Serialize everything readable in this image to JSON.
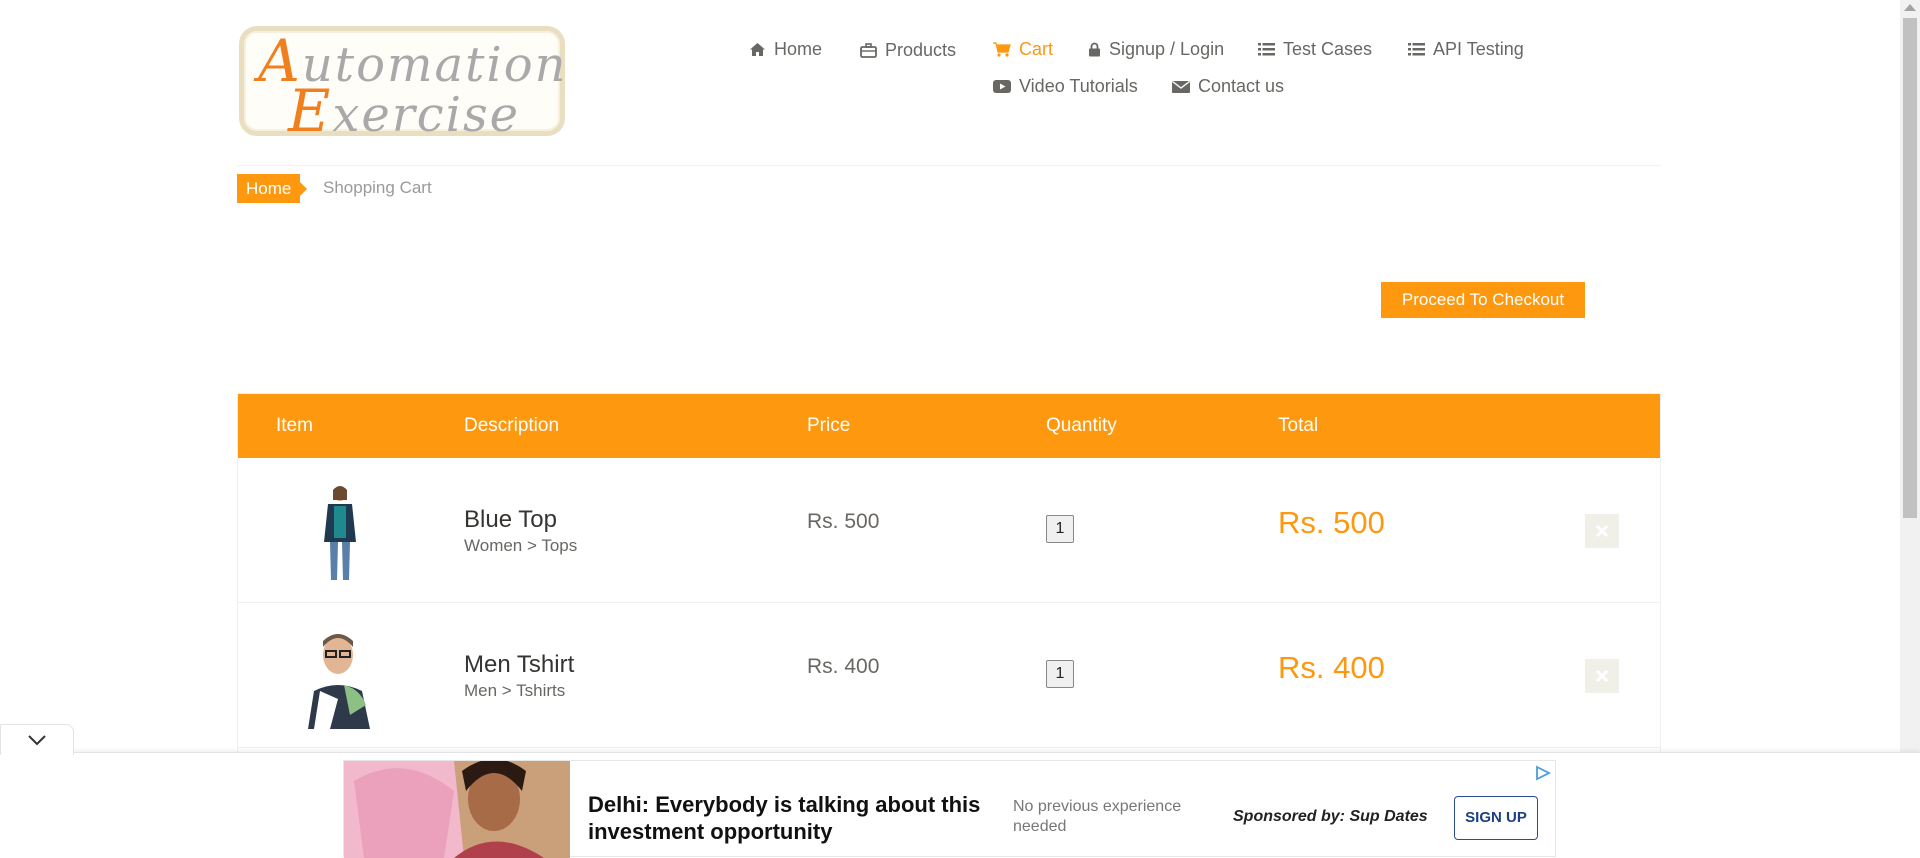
{
  "logo": {
    "line1_cap": "A",
    "line1_rest": "utomation",
    "line2_cap": "E",
    "line2_rest": "xercise"
  },
  "nav": {
    "items": [
      {
        "label": "Home",
        "icon": "home-icon"
      },
      {
        "label": "Products",
        "icon": "briefcase-icon"
      },
      {
        "label": "Cart",
        "icon": "cart-icon",
        "active": true
      },
      {
        "label": "Signup / Login",
        "icon": "lock-icon"
      },
      {
        "label": "Test Cases",
        "icon": "list-icon"
      },
      {
        "label": "API Testing",
        "icon": "list-icon"
      },
      {
        "label": "Video Tutorials",
        "icon": "youtube-icon"
      },
      {
        "label": "Contact us",
        "icon": "envelope-icon"
      }
    ]
  },
  "breadcrumb": {
    "home": "Home",
    "current": "Shopping Cart"
  },
  "checkout": {
    "label": "Proceed To Checkout"
  },
  "table": {
    "headers": [
      "Item",
      "Description",
      "Price",
      "Quantity",
      "Total"
    ],
    "rows": [
      {
        "name": "Blue Top",
        "category": "Women > Tops",
        "price": "Rs. 500",
        "quantity": "1",
        "total": "Rs. 500"
      },
      {
        "name": "Men Tshirt",
        "category": "Men > Tshirts",
        "price": "Rs. 400",
        "quantity": "1",
        "total": "Rs. 400"
      }
    ]
  },
  "ad": {
    "headline": "Delhi: Everybody is talking about this investment opportunity",
    "sub": "No previous experience needed",
    "sponsor": "Sponsored by: Sup Dates",
    "cta": "SIGN UP"
  },
  "colors": {
    "accent": "#fe980f",
    "text": "#696763",
    "heading": "#363432"
  }
}
